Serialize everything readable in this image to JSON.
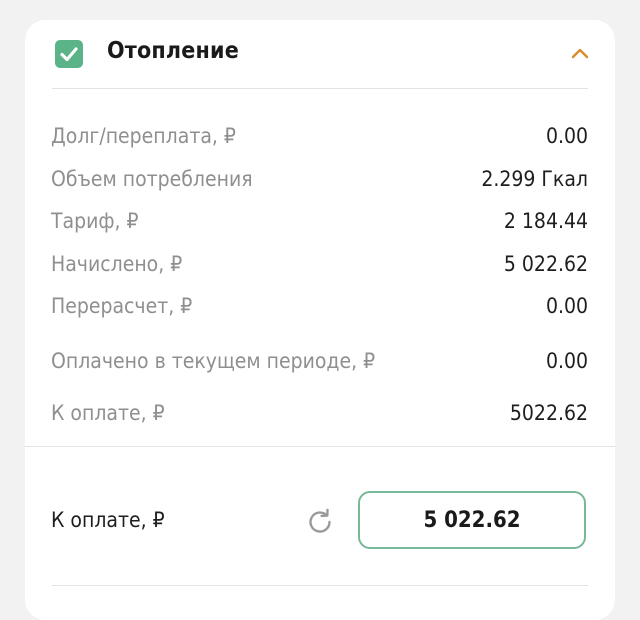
{
  "section": {
    "title": "Отопление",
    "checked": true,
    "expanded": true,
    "accent_color": "#5bb388",
    "chevron_color": "#d98b2b"
  },
  "rows": [
    {
      "label": "Долг/переплата, ₽",
      "value": "0.00"
    },
    {
      "label": "Объем потребления",
      "value": "2.299 Гкал"
    },
    {
      "label": "Тариф, ₽",
      "value": "2 184.44"
    },
    {
      "label": "Начислено, ₽",
      "value": "5 022.62"
    },
    {
      "label": "Перерасчет, ₽",
      "value": "0.00"
    },
    {
      "label": "Оплачено в текущем периоде, ₽",
      "value": "0.00"
    },
    {
      "label": "К оплате, ₽",
      "value": "5022.62"
    }
  ],
  "payment": {
    "label": "К оплате, ₽",
    "amount": "5 022.62"
  },
  "icons": {
    "checkbox": "checkbox-checked-icon",
    "collapse": "chevron-up-icon",
    "refresh": "refresh-icon"
  }
}
